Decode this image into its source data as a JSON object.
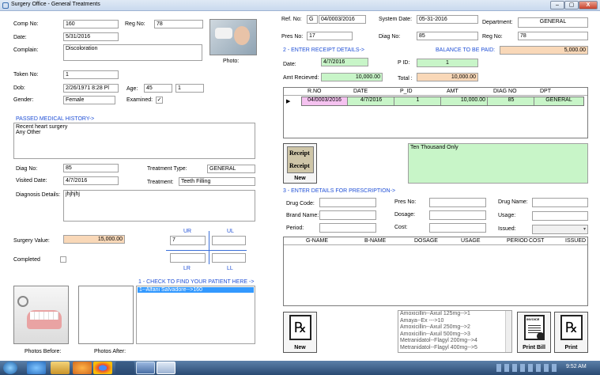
{
  "window": {
    "title": "Surgery Office - General Treatments",
    "min": "–",
    "max": "▢",
    "close": "X"
  },
  "left": {
    "comp_no_label": "Comp No:",
    "comp_no": "160",
    "reg_no_label": "Reg No:",
    "reg_no": "78",
    "date_label": "Date:",
    "date": "5/31/2016",
    "complain_label": "Complain:",
    "complain": "Discoloration",
    "photo_label": "Photo:",
    "token_label": "Token No:",
    "token": "1",
    "dob_label": "Dob:",
    "dob": "2/26/1971 8:28 Pl",
    "age_label": "Age:",
    "age": "45",
    "age2": "1",
    "gender_label": "Gender:",
    "gender": "Female",
    "examined_label": "Examined:",
    "examined_check": "✓",
    "history_title": "PASSED MEDICAL HISTORY->",
    "history_line1": "Recent heart surgery",
    "history_line2": "Any Other",
    "diag_no_label": "Diag No:",
    "diag_no": "85",
    "treat_type_label": "Treatment Type:",
    "treat_type": "GENERAL",
    "visited_label": "Visited Date:",
    "visited": "4/7/2016",
    "treatment_label": "Treatment:",
    "treatment": "Teeth Filling",
    "diag_details_label": "Diagnosis Details:",
    "diag_details": "jhjhjhj",
    "surgery_value_label": "Surgery Value:",
    "surgery_value": "15,000.00",
    "completed_label": "Completed",
    "ur": "UR",
    "ul": "UL",
    "lr": "LR",
    "ll": "LL",
    "ur_val": "7",
    "patient_title": "1 - CHECK TO FIND YOUR PATIENT HERE ->",
    "patient_item": "1--Alfani Salvadore-->160",
    "photos_before": "Photos Before:",
    "photos_after": "Photos After:"
  },
  "right": {
    "ref_label": "Ref. No:",
    "ref_prefix": "G",
    "ref_no": "04/0003/2016",
    "sys_date_label": "System Date:",
    "sys_date": "05-31-2016",
    "dept_label": "Department:",
    "dept": "GENERAL",
    "pres_no_label": "Pres No:",
    "pres_no": "17",
    "diag_no_label": "Diag No:",
    "diag_no": "85",
    "reg_no_label": "Reg No:",
    "reg_no": "78",
    "receipt_title": "2 - ENTER RECEIPT DETAILS->",
    "balance_label": "BALANCE TO BE PAID:",
    "balance": "5,000.00",
    "date_label": "Date:",
    "date": "4/7/2016",
    "pid_label": "P ID:",
    "pid": "1",
    "amt_label": "Amt Recieved:",
    "amt": "10,000.00",
    "total_label": "Total :",
    "total": "10,000.00",
    "receipt_cols": [
      "R.NO",
      "DATE",
      "P_ID",
      "AMT",
      "DIAG NO",
      "DPT"
    ],
    "receipt_row": [
      "04/0003/2016",
      "4/7/2016",
      "1",
      "10,000.00",
      "85",
      "GENERAL"
    ],
    "receipt_btn_top": "Receipt",
    "receipt_btn_mid": "Receipt",
    "receipt_btn": "New",
    "amount_words": "Ten Thousand Only",
    "presc_title": "3 - ENTER DETAILS FOR PRESCRIPTION->",
    "drug_code_label": "Drug Code:",
    "pres_no2_label": "Pres No:",
    "drug_name_label": "Drug Name:",
    "brand_label": "Brand Name:",
    "dosage_label": "Dosage:",
    "usage_label": "Usage:",
    "period_label": "Period:",
    "cost_label": "Cost:",
    "issued_label": "Issued:",
    "presc_cols": [
      "G-NAME",
      "B-NAME",
      "DOSAGE",
      "USAGE",
      "PERIOD",
      "COST",
      "ISSUED"
    ],
    "drugs": [
      "Amoxicillin--Axuil 125mg-->1",
      "Amaya--Ex --->10",
      "Amoxicillin--Axuil 250mg-->2",
      "Amoxicillin--Axuil 500mg-->3",
      "Metranidatol--Flagyl 200mg-->4",
      "Metranidatol--Flagyl 400mg-->5"
    ],
    "new_btn": "New",
    "print_bill": "Print Bill",
    "print": "Print",
    "invoice": "INVOICE"
  },
  "taskbar": {
    "time": "9:52 AM"
  }
}
